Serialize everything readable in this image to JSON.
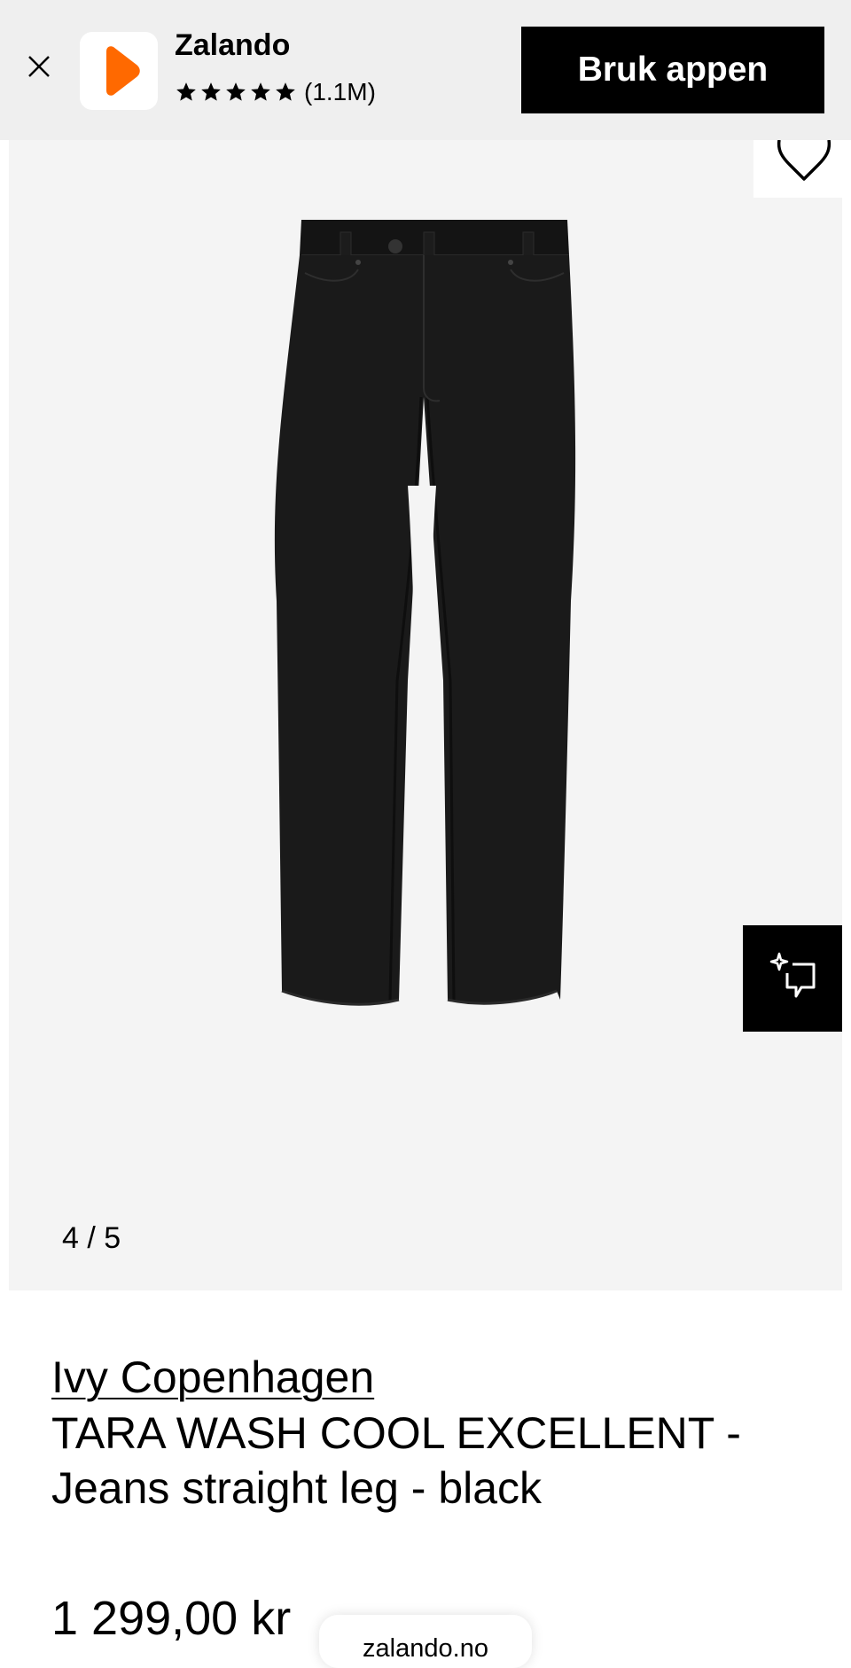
{
  "banner": {
    "app_name": "Zalando",
    "rating_count": "(1.1M)",
    "stars": 5,
    "open_app_label": "Bruk appen",
    "icon_color": "#ff6900"
  },
  "gallery": {
    "counter": "4 / 5",
    "product_color": "#1a1a1a"
  },
  "product": {
    "brand": "Ivy Copenhagen",
    "title": "TARA WASH COOL EXCELLENT - Jeans straight leg - black",
    "price": "1 299,00 kr"
  },
  "browser": {
    "url": "zalando.no"
  },
  "icons": [
    "close-icon",
    "zalando-logo-icon",
    "star-icon",
    "heart-icon",
    "ai-sparkle-icon"
  ]
}
